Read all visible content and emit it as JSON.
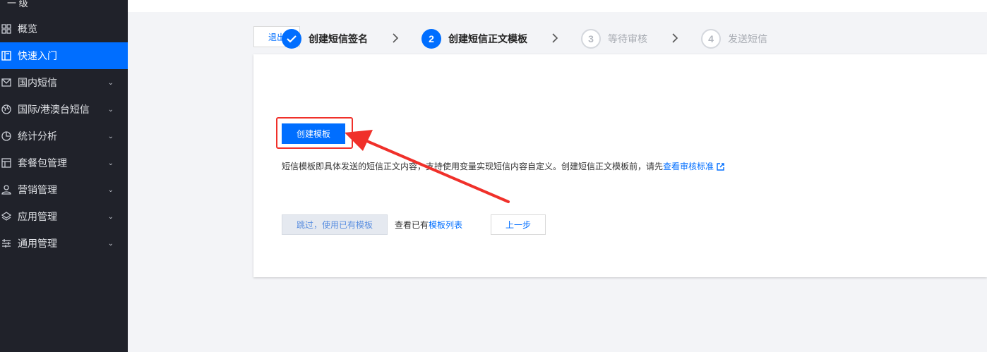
{
  "sidebar": {
    "top_glyph": "一 级",
    "items": [
      {
        "label": "概览",
        "icon": "grid-icon",
        "has_chevron": false,
        "active": false
      },
      {
        "label": "快速入门",
        "icon": "book-icon",
        "has_chevron": false,
        "active": true
      },
      {
        "label": "国内短信",
        "icon": "mail-icon",
        "has_chevron": true,
        "active": false
      },
      {
        "label": "国际/港澳台短信",
        "icon": "globe-icon",
        "has_chevron": true,
        "active": false
      },
      {
        "label": "统计分析",
        "icon": "pie-chart-icon",
        "has_chevron": true,
        "active": false
      },
      {
        "label": "套餐包管理",
        "icon": "package-icon",
        "has_chevron": true,
        "active": false
      },
      {
        "label": "营销管理",
        "icon": "users-icon",
        "has_chevron": true,
        "active": false
      },
      {
        "label": "应用管理",
        "icon": "layers-icon",
        "has_chevron": true,
        "active": false
      },
      {
        "label": "通用管理",
        "icon": "sliders-icon",
        "has_chevron": true,
        "active": false
      }
    ],
    "chevron": "⌄"
  },
  "toolbar": {
    "exit_label": "退出"
  },
  "steps": [
    {
      "number": "",
      "label": "创建短信签名",
      "status": "done"
    },
    {
      "number": "2",
      "label": "创建短信正文模板",
      "status": "current"
    },
    {
      "number": "3",
      "label": "等待审核",
      "status": "pending"
    },
    {
      "number": "4",
      "label": "发送短信",
      "status": "pending"
    }
  ],
  "main": {
    "create_button": "创建模板",
    "description": "短信模板即具体发送的短信正文内容，支持使用变量实现短信内容自定义。创建短信正文模板前，请先",
    "description_link": "查看审核标准",
    "skip_button": "跳过，使用已有模板",
    "view_list_prefix": "查看已有",
    "view_list_link": "模板列表",
    "prev_button": "上一步"
  },
  "colors": {
    "accent": "#006eff",
    "sidebar_bg": "#20222a",
    "annotation_red": "#f0302a"
  }
}
